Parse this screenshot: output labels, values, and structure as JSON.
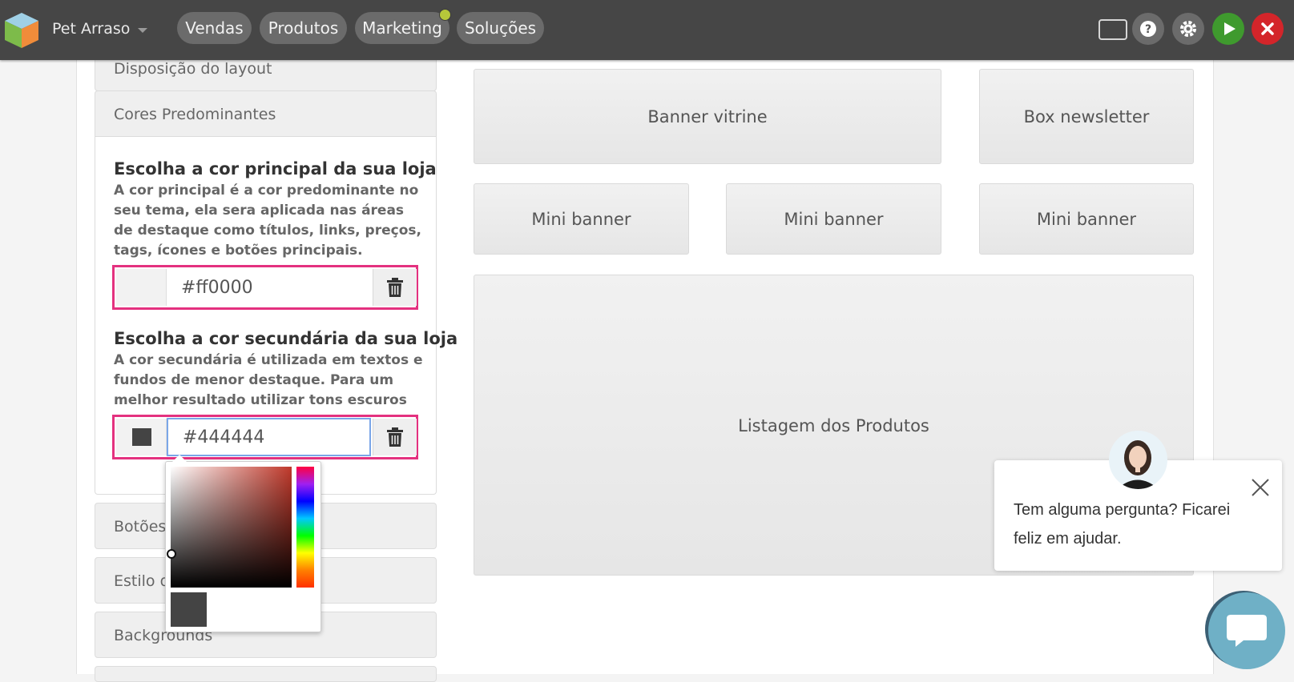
{
  "app": {
    "store_name": "Pet Arraso",
    "nav": [
      "Vendas",
      "Produtos",
      "Marketing",
      "Soluções"
    ],
    "tools": [
      "monitor-icon",
      "help-icon",
      "gear-icon",
      "play-icon",
      "close-icon"
    ],
    "colors": {
      "topbar": "#464646",
      "play": "#3f9a2e",
      "close": "#d4252a",
      "highlight": "#e4317f"
    }
  },
  "sidebar": {
    "sections": {
      "layout": "Disposição do layout",
      "colors": "Cores Predominantes",
      "buttons": "Botões",
      "style": "Estilo d",
      "backgrounds": "Backgrounds"
    },
    "primary": {
      "title": "Escolha a cor principal da sua loja",
      "description": "A cor principal é a cor predominante no seu tema, ela sera aplicada nas áreas de destaque como títulos, links, preços, tags, ícones e botões principais.",
      "value": "#ff0000",
      "swatch": "#f2f2f2"
    },
    "secondary": {
      "title": "Escolha a cor secundária da sua loja",
      "description": "A cor secundária é utilizada em textos e fundos de menor destaque. Para um melhor resultado utilizar tons escuros",
      "value": "#444444",
      "swatch": "#444444"
    }
  },
  "layout_blocks": {
    "banner": "Banner vitrine",
    "newsletter": "Box newsletter",
    "mini_banners": [
      "Mini banner",
      "Mini banner",
      "Mini banner"
    ],
    "products": "Listagem dos Produtos"
  },
  "chat": {
    "message": "Tem alguma pergunta? Ficarei feliz em ajudar."
  }
}
